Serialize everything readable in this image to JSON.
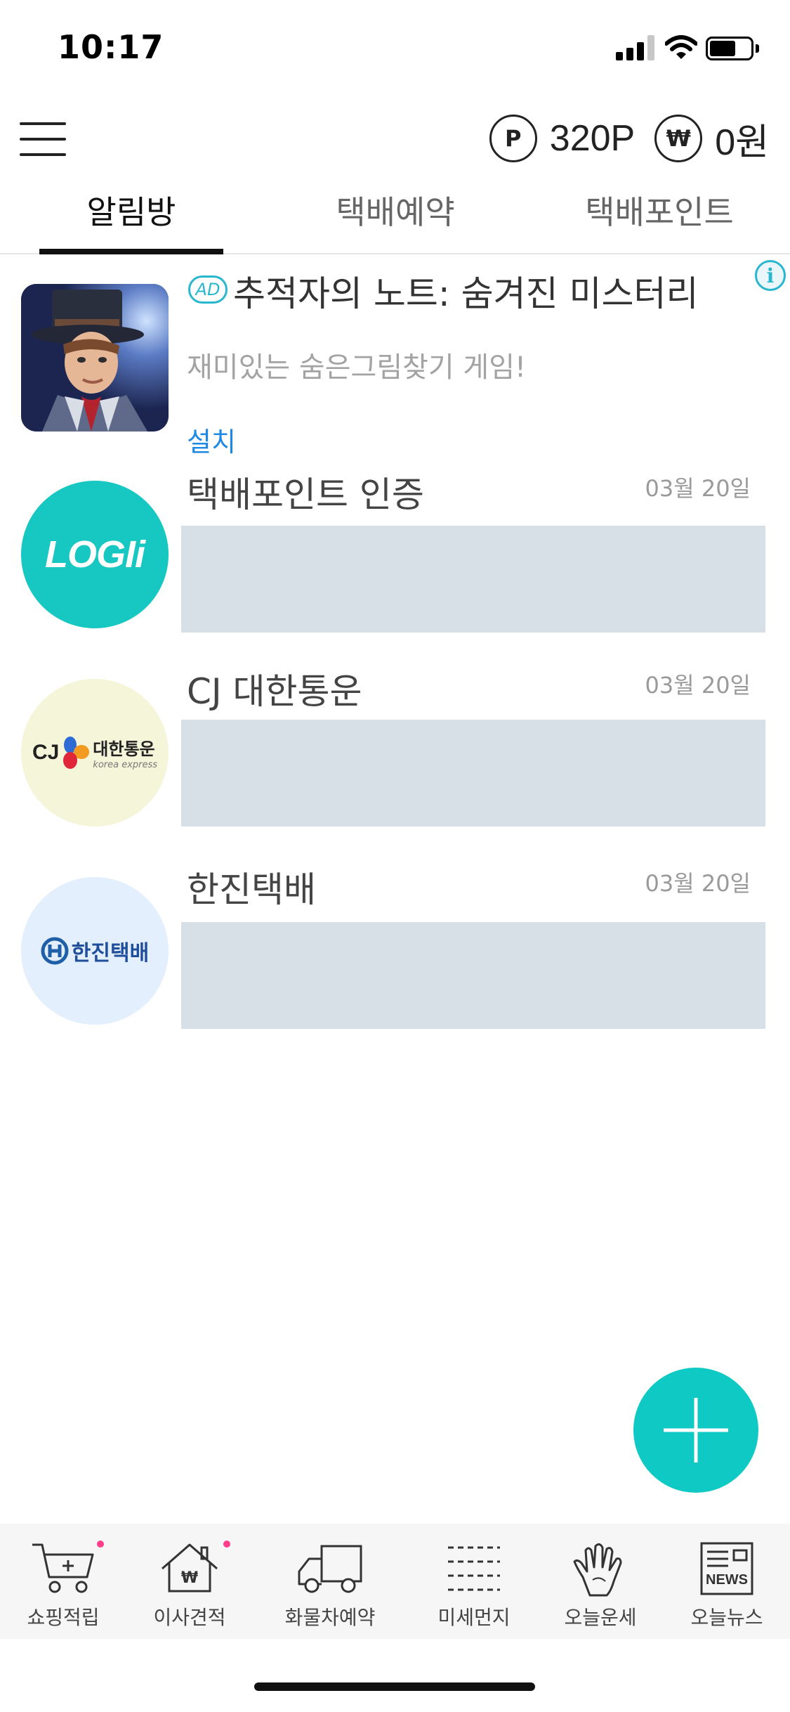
{
  "status_bar": {
    "time": "10:17"
  },
  "header": {
    "point_symbol": "P",
    "points": "320P",
    "won_symbol": "₩",
    "won": "0원"
  },
  "tabs": [
    {
      "label": "알림방",
      "active": true
    },
    {
      "label": "택배예약",
      "active": false
    },
    {
      "label": "택배포인트",
      "active": false
    }
  ],
  "ad": {
    "badge": "AD",
    "info": "i",
    "title": "추적자의 노트: 숨겨진 미스터리",
    "description": "재미있는 숨은그림찾기 게임!",
    "install": "설치"
  },
  "notices": [
    {
      "title": "택배포인트 인증",
      "date": "03월 20일",
      "logo_text": "LOGIi",
      "logo_bg": "#16c7c2"
    },
    {
      "title": "CJ 대한통운",
      "date": "03월 20일",
      "logo_text": "CJ",
      "logo_sub": "대한통운",
      "logo_sub2": "korea express",
      "logo_bg": "#f4f5d9"
    },
    {
      "title": "한진택배",
      "date": "03월 20일",
      "logo_text": "한진택배",
      "logo_bg": "#e3effc"
    }
  ],
  "fab": {
    "icon": "plus-icon"
  },
  "bottom_nav": [
    {
      "label": "쇼핑적립",
      "icon": "cart-icon",
      "dot": true
    },
    {
      "label": "이사견적",
      "icon": "house-won-icon",
      "dot": true
    },
    {
      "label": "화물차예약",
      "icon": "truck-icon",
      "dot": false
    },
    {
      "label": "미세먼지",
      "icon": "dust-icon",
      "dot": false
    },
    {
      "label": "오늘운세",
      "icon": "hand-icon",
      "dot": false
    },
    {
      "label": "오늘뉴스",
      "icon": "news-icon",
      "dot": false
    }
  ],
  "colors": {
    "accent": "#0fcac4",
    "link": "#1e88e5",
    "placeholder": "#d8e0e7"
  }
}
